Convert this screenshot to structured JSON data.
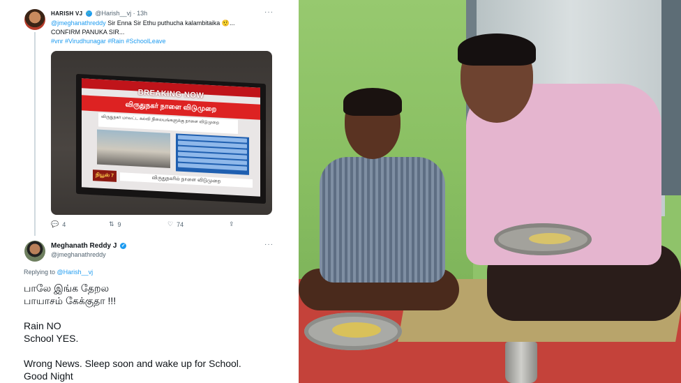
{
  "tweet1": {
    "author_name": "HARISH VJ",
    "author_handle": "@Harish__vj",
    "time": "· 13h",
    "more": "···",
    "text_mention": "@jmeghanathreddy",
    "text_line1": " Sir Enna Sir Ethu  puthucha kalambitaika 🤨...",
    "text_line2": "CONFIRM PANUKA SIR...",
    "hashtags": "#vnr #Virudhunagar #Rain #SchoolLeave",
    "image_text": {
      "breaking": "BREAKING NOW",
      "headline": "விருதுநகர் நாளை விடுமுறை",
      "sub": "விருதுநகர் மாவட்ட கல்வி நிலையங்களுக்கு நாளை விடுமுறை",
      "ticker": "விருதுநகரில் நாளை விடுமுறை",
      "logo": "நியூஸ் 7"
    },
    "replies": "4",
    "retweets": "9",
    "likes": "74"
  },
  "tweet2": {
    "author_name": "Meghanath Reddy J",
    "author_handle": "@jmeghanathreddy",
    "more": "···",
    "replying_prefix": "Replying to ",
    "replying_to": "@Harish__vj",
    "line1": "பாலே இங்க தேறல",
    "line2": "பாயாசம் கேக்குதா !!!",
    "line3": "Rain NO",
    "line4": "School YES.",
    "line5": "Wrong News. Sleep soon and wake up for School.",
    "line6": "Good Night"
  }
}
